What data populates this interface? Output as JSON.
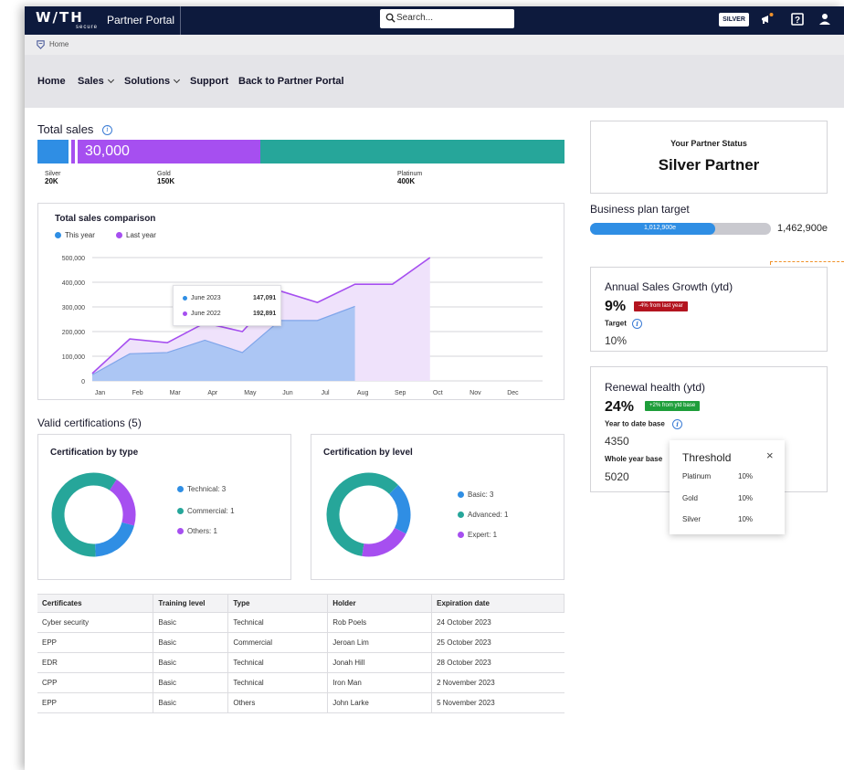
{
  "header": {
    "brand": "W/TH",
    "brand_sub": "secure",
    "portal_name": "Partner Portal",
    "search_placeholder": "Search...",
    "tier_badge": "SILVER",
    "icons": [
      "megaphone-icon",
      "help-icon",
      "user-icon"
    ]
  },
  "breadcrumb": {
    "label": "Home"
  },
  "nav": {
    "items": [
      {
        "label": "Home"
      },
      {
        "label": "Sales"
      },
      {
        "label": "Solutions"
      },
      {
        "label": "Support"
      },
      {
        "label": "Back to Partner Portal"
      }
    ]
  },
  "total_sales": {
    "title": "Total sales",
    "value": "30,000",
    "current": 30000,
    "tiers": [
      {
        "name": "Silver",
        "value": "20K"
      },
      {
        "name": "Gold",
        "value": "150K"
      },
      {
        "name": "Platinum",
        "value": "400K"
      }
    ],
    "colors": {
      "silver": "#2f8ee4",
      "gold": "#a64ff0",
      "platinum": "#26a69a"
    }
  },
  "chart_data": {
    "type": "area",
    "title": "Total sales comparison",
    "categories": [
      "Jan",
      "Feb",
      "Mar",
      "Apr",
      "May",
      "Jun",
      "Jul",
      "Aug",
      "Sep",
      "Oct",
      "Nov",
      "Dec"
    ],
    "series": [
      {
        "name": "This year",
        "color": "#2f8ee4",
        "values": [
          25000,
          110000,
          115000,
          165000,
          115000,
          245000,
          245000,
          302000
        ]
      },
      {
        "name": "Last year",
        "color": "#a64ff0",
        "values": [
          30000,
          170000,
          155000,
          235000,
          200000,
          365000,
          318000,
          392000,
          392000,
          500000
        ]
      }
    ],
    "y_ticks": [
      "500,000",
      "400,000",
      "300,000",
      "200,000",
      "100,000",
      "0"
    ],
    "ylim": [
      0,
      500000
    ],
    "grid": true,
    "legend": "top-left",
    "tooltip": [
      {
        "label": "June 2023",
        "value": "147,091"
      },
      {
        "label": "June 2022",
        "value": "192,891"
      }
    ]
  },
  "certifications": {
    "title": "Valid certifications (5)",
    "by_type": {
      "title": "Certification by type",
      "slices": [
        {
          "label": "Technical: 3",
          "value": 3,
          "color": "#26a69a"
        },
        {
          "label": "Commercial: 1",
          "value": 1,
          "color": "#a64ff0"
        },
        {
          "label": "Others: 1",
          "value": 1,
          "color": "#2f8ee4"
        }
      ],
      "legend_colors": [
        "#2f8ee4",
        "#26a69a",
        "#a64ff0"
      ]
    },
    "by_level": {
      "title": "Certification by level",
      "slices": [
        {
          "label": "Basic: 3",
          "value": 3,
          "color": "#26a69a"
        },
        {
          "label": "Advanced: 1",
          "value": 1,
          "color": "#2f8ee4"
        },
        {
          "label": "Expert: 1",
          "value": 1,
          "color": "#a64ff0"
        }
      ],
      "legend_colors": [
        "#2f8ee4",
        "#26a69a",
        "#a64ff0"
      ]
    }
  },
  "table": {
    "headers": [
      "Certificates",
      "Training level",
      "Type",
      "Holder",
      "Expiration date"
    ],
    "rows": [
      [
        "Cyber security",
        "Basic",
        "Technical",
        "Rob Poels",
        "24 October 2023"
      ],
      [
        "EPP",
        "Basic",
        "Commercial",
        "Jeroan Lim",
        "25 October 2023"
      ],
      [
        "EDR",
        "Basic",
        "Technical",
        "Jonah Hill",
        "28 October 2023"
      ],
      [
        "CPP",
        "Basic",
        "Technical",
        "Iron Man",
        "2 November 2023"
      ],
      [
        "EPP",
        "Basic",
        "Others",
        "John Larke",
        "5 November 2023"
      ]
    ]
  },
  "partner_status": {
    "label": "Your Partner Status",
    "value": "Silver Partner"
  },
  "business_plan": {
    "title": "Business plan target",
    "achieved": "1,012,900e",
    "target": "1,462,900e",
    "progress": 0.692
  },
  "annual_growth": {
    "title": "Annual Sales Growth (ytd)",
    "value": "9%",
    "badge": "-4% from last year",
    "badge_color": "#b3141f",
    "target_label": "Target",
    "target_value": "10%"
  },
  "renewal": {
    "title": "Renewal health (ytd)",
    "value": "24%",
    "badge": "+2% from ytd base",
    "badge_color": "#1e9e3a",
    "ytd_label": "Year to date base",
    "ytd_value": "4350",
    "whole_label": "Whole year base",
    "whole_value": "5020"
  },
  "threshold": {
    "title": "Threshold",
    "close": "×",
    "rows": [
      {
        "name": "Platinum",
        "pct": "10%"
      },
      {
        "name": "Gold",
        "pct": "10%"
      },
      {
        "name": "Silver",
        "pct": "10%"
      }
    ]
  }
}
